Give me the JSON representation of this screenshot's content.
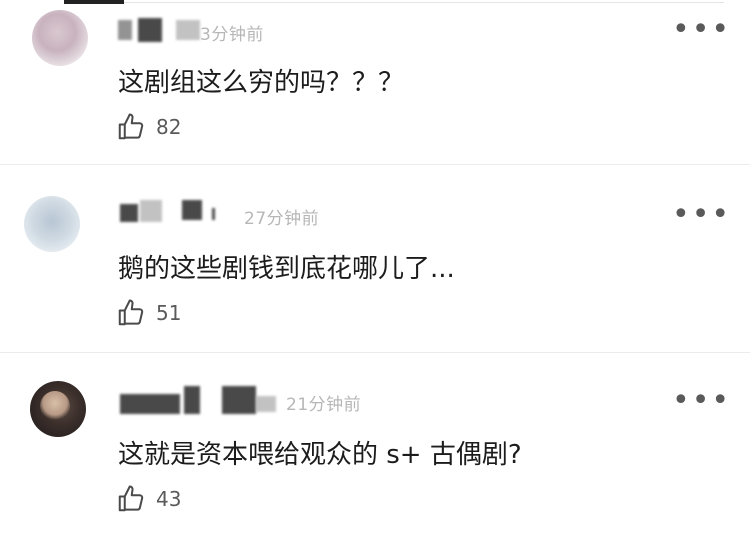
{
  "comments": [
    {
      "time": "3分钟前",
      "text": "这剧组这么穷的吗？？？",
      "likes": "82"
    },
    {
      "time": "27分钟前",
      "text": "鹅的这些剧钱到底花哪儿了...",
      "likes": "51"
    },
    {
      "time": "21分钟前",
      "text": "这就是资本喂给观众的 s+ 古偶剧?",
      "likes": "43"
    }
  ],
  "more_glyph": "•••",
  "icons": {
    "like": "thumbs-up-icon",
    "more": "more-options-icon"
  }
}
